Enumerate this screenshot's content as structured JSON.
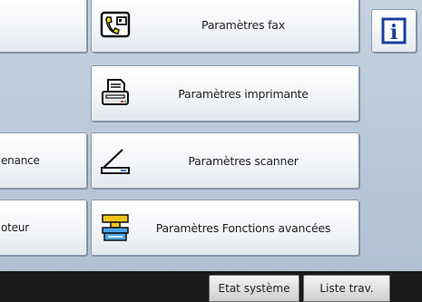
{
  "left_column": {
    "items": [
      {
        "label": "enance"
      },
      {
        "label": "oteur"
      }
    ]
  },
  "menu": {
    "fax": {
      "label": "Paramètres fax",
      "icon": "fax-settings-icon"
    },
    "printer": {
      "label": "Paramètres imprimante",
      "icon": "printer-icon"
    },
    "scanner": {
      "label": "Paramètres scanner",
      "icon": "scanner-icon"
    },
    "extended": {
      "label": "Paramètres Fonctions avancées",
      "icon": "extended-features-icon"
    }
  },
  "info_button": {
    "glyph": "i",
    "icon": "info-icon"
  },
  "bottom_bar": {
    "system_status": "Etat système",
    "job_list": "Liste trav."
  },
  "colors": {
    "background": "#b7c6d6",
    "info_blue": "#1b3f9e",
    "bar": "#1a1a1a"
  }
}
